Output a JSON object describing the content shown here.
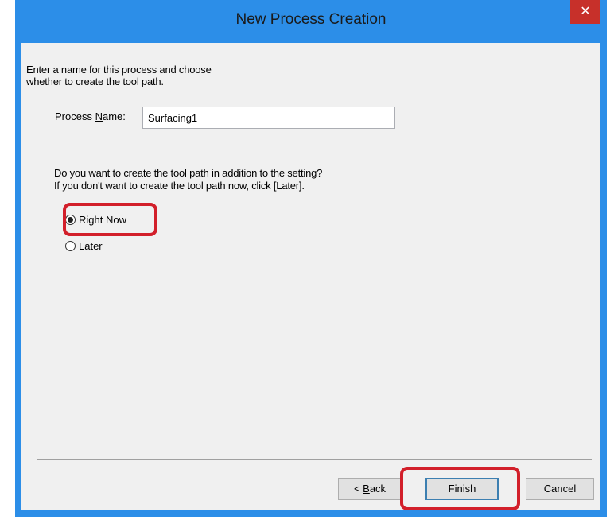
{
  "window": {
    "title": "New Process Creation",
    "close_glyph": "✕",
    "accent": "#2c8ee8"
  },
  "intro": {
    "line1": "Enter a name for this process and choose",
    "line2": "whether to create the tool path."
  },
  "process_name": {
    "label_pre": "Process ",
    "label_mnemonic": "N",
    "label_post": "ame:",
    "value": "Surfacing1"
  },
  "question": {
    "line1": "Do you want to create the tool path in addition to the setting?",
    "line2": "If you don't want to create the tool path now, click [Later]."
  },
  "options": [
    {
      "label": "Right Now",
      "selected": true
    },
    {
      "label": "Later",
      "selected": false
    }
  ],
  "buttons": {
    "back_pre": "< ",
    "back_mnemonic": "B",
    "back_post": "ack",
    "finish": "Finish",
    "cancel": "Cancel"
  },
  "highlight_color": "#d21f2a"
}
